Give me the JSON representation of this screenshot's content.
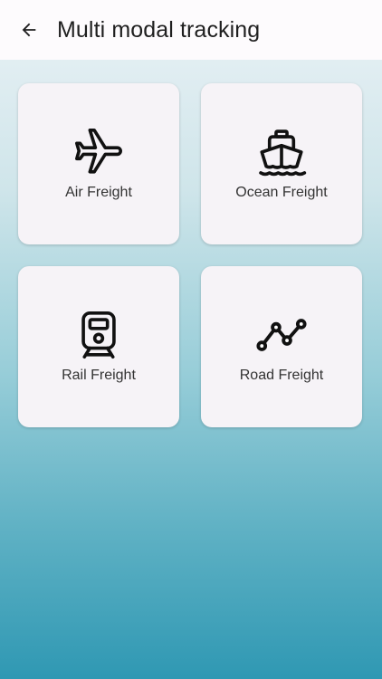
{
  "appbar": {
    "title": "Multi modal tracking",
    "back_icon": "arrow-back-icon"
  },
  "cards": [
    {
      "label": "Air Freight",
      "icon": "airplane-icon"
    },
    {
      "label": "Ocean Freight",
      "icon": "ship-icon"
    },
    {
      "label": "Rail Freight",
      "icon": "train-icon"
    },
    {
      "label": "Road Freight",
      "icon": "route-line-icon"
    }
  ],
  "colors": {
    "appbar_bg": "#fdfbfd",
    "card_bg": "#f6f3f7",
    "gradient_top": "#eaf2f6",
    "gradient_bottom": "#2f98b3"
  }
}
